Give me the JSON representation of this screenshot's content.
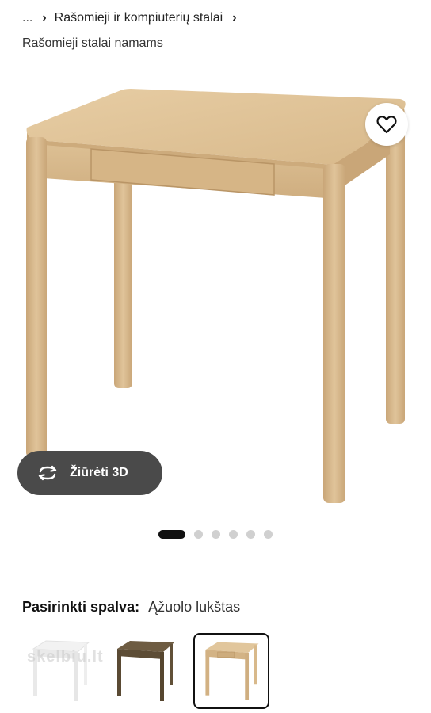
{
  "breadcrumb": {
    "ellipsis": "...",
    "separator": "›",
    "current": "Rašomieji ir kompiuterių stalai"
  },
  "subcategory": "Rašomieji stalai namams",
  "view3d": {
    "label": "Žiūrėti 3D"
  },
  "carousel": {
    "count": 6,
    "active_index": 0
  },
  "color_selector": {
    "title": "Pasirinkti spalva:",
    "value": "Ąžuolo lukštas",
    "options": [
      {
        "name": "white",
        "color": "#f4f4f4"
      },
      {
        "name": "dark-brown",
        "color": "#6b5a40"
      },
      {
        "name": "oak-veneer",
        "color": "#d8b98d",
        "selected": true
      }
    ]
  },
  "watermark": "skelbiu.lt",
  "colors": {
    "oak": "#d9bc90",
    "oak_dark": "#c29e6e",
    "pill_bg": "#4a4a4a"
  }
}
